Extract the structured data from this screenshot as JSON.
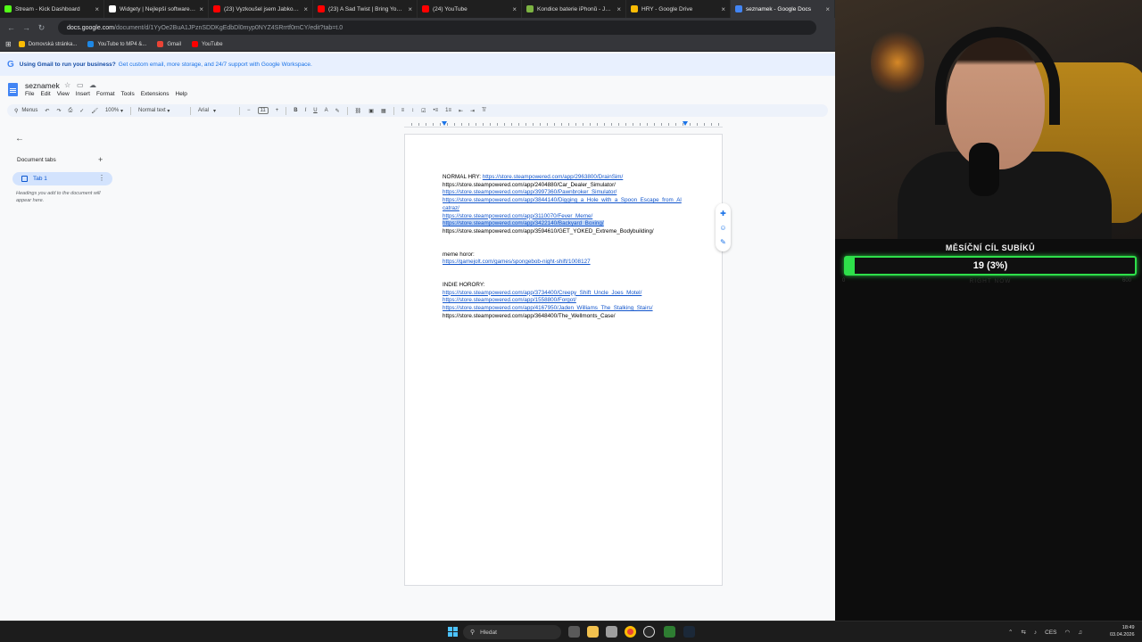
{
  "browser": {
    "tabs": [
      {
        "label": "Stream - Kick Dashboard",
        "color": "#53fc18"
      },
      {
        "label": "Widgety | Nejlepší software pro",
        "color": "#ffffff"
      },
      {
        "label": "(23) Vyzkoušel jsem JabkoLevn",
        "color": "#ff0000"
      },
      {
        "label": "(23) A Sad Twist | Bring You Ho",
        "color": "#ff0000"
      },
      {
        "label": "(24) YouTube",
        "color": "#ff0000"
      },
      {
        "label": "Kondice baterie iPhonů - Jabko",
        "color": "#7cb342"
      },
      {
        "label": "HRY - Google Drive",
        "color": "#fbbc04"
      },
      {
        "label": "seznamek - Google Docs",
        "color": "#4285f4"
      }
    ],
    "url_host": "docs.google.com",
    "url_path": "/document/d/1YyOe2BuA1JPznSDDKgEdbDl0myp0NYZ4SRrrtf0mCY/edit?tab=t.0",
    "bookmarks": [
      {
        "label": "Domovská stránka...",
        "color": "#fbbc04"
      },
      {
        "label": "YouTube to MP4 &...",
        "color": "#1e88e5"
      },
      {
        "label": "Gmail",
        "color": "#ea4335"
      },
      {
        "label": "YouTube",
        "color": "#ff0000"
      }
    ]
  },
  "banner": {
    "bold": "Using Gmail to run your business?",
    "text": "Get custom email, more storage, and 24/7 support with Google Workspace."
  },
  "docs": {
    "title": "seznamek",
    "menu": [
      "File",
      "Edit",
      "View",
      "Insert",
      "Format",
      "Tools",
      "Extensions",
      "Help"
    ],
    "toolbar": {
      "search": "Menus",
      "zoom": "100%",
      "style": "Normal text",
      "font": "Arial",
      "font_size": "11"
    },
    "sidebar": {
      "heading": "Document tabs",
      "tab_label": "Tab 1",
      "hint": "Headings you add to the document will appear here."
    }
  },
  "document": {
    "section1_heading": "NORMAL HRY: ",
    "line1": "https://store.steampowered.com/app/2963800/DrainSim/",
    "line2": "https://store.steampowered.com/app/2404880/Car_Dealer_Simulator/",
    "line3": "https://store.steampowered.com/app/3997360/Pawnbroker_Simulator/",
    "line4": "https://store.steampowered.com/app/3844140/Digging_a_Hole_with_a_Spoon_Escape_from_Alcatraz/",
    "line5": "https://store.steampowered.com/app/3110070/Fever_Meme/",
    "line6": "https://store.steampowered.com/app/3422140/Backyard_Boxing/",
    "line7": "https://store.steampowered.com/app/3594610/GET_YOKED_Extreme_Bodybuilding/",
    "section2_heading": "meme horor:",
    "line8": "https://gamejolt.com/games/spongebob-night-shift/1008127",
    "section3_heading": "INDIE HORORY:",
    "line9": "https://store.steampowered.com/app/3734400/Creepy_Shift_Uncle_Joes_Motel/",
    "line10": "https://store.steampowered.com/app/1558800/Forgot/",
    "line11": "https://store.steampowered.com/app/4167950/Jaden_Williams_The_Stalking_Stairs/",
    "line12": "https://store.steampowered.com/app/3648400/The_Wellmonts_Case/"
  },
  "overlay": {
    "goal_title": "MĚSÍČNÍ CÍL SUBÍKŮ",
    "goal_value": "19 (3%)",
    "goal_fraction": 0.03,
    "goal_min": "0",
    "goal_label": "RIGHT NOW",
    "goal_max": "600",
    "accent": "#2ee04a"
  },
  "taskbar": {
    "search_placeholder": "Hledat",
    "language": "CES",
    "time": "18:49",
    "date": "03.04.2026"
  }
}
